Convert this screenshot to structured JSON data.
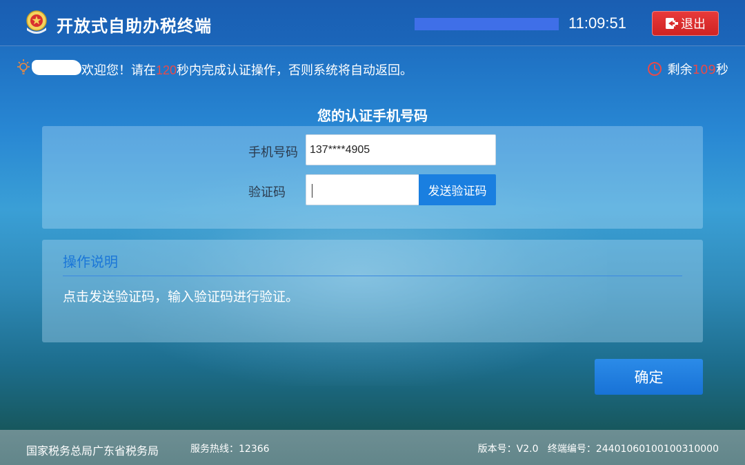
{
  "header": {
    "title": "开放式自助办税终端",
    "time": "11:09:51",
    "exit_label": "退出",
    "progress_percent": 100
  },
  "notice": {
    "welcome_prefix": "欢迎您！请在",
    "limit_seconds": "120",
    "welcome_suffix": "秒内完成认证操作，否则系统将自动返回。",
    "remaining_prefix": "剩余",
    "remaining_seconds": "109",
    "remaining_suffix": "秒"
  },
  "form": {
    "title": "您的认证手机号码",
    "phone_label": "手机号码",
    "phone_value": "137****4905",
    "code_label": "验证码",
    "code_value": "",
    "send_code_label": "发送验证码"
  },
  "help": {
    "title": "操作说明",
    "text": "点击发送验证码，输入验证码进行验证。"
  },
  "confirm_label": "确定",
  "footer": {
    "org": "国家税务总局广东省税务局",
    "hotline": "服务热线：12366",
    "version": "版本号：V2.0",
    "terminal": "终端编号：24401060100100310000"
  },
  "colors": {
    "accent": "#1a7fe0",
    "exit_red": "#d92b2b",
    "highlight_red": "#e84a4a",
    "footer_bg": "#6d8e93"
  },
  "icons": {
    "emblem": "tax-emblem-icon",
    "bulb": "lightbulb-icon",
    "timer": "clock-icon",
    "exit": "logout-icon"
  }
}
